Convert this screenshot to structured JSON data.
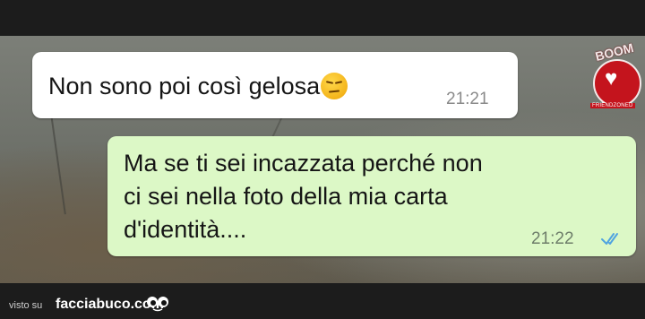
{
  "chat": {
    "received": {
      "text": "Non sono poi così gelosa",
      "emoji": "unamused-face-emoji",
      "time": "21:21"
    },
    "sent": {
      "lines": [
        "Ma se ti sei incazzata perché non",
        "ci sei nella foto della mia carta",
        "d'identità...."
      ],
      "time": "21:22",
      "status": "read-double-check"
    }
  },
  "watermark": {
    "logo_text": "BOOM",
    "logo_sub": "FRIENDZONED"
  },
  "footer": {
    "prefix": "visto su",
    "site": "facciabuco.com"
  },
  "colors": {
    "received_bubble": "#ffffff",
    "sent_bubble": "#dcf8c6",
    "read_ticks": "#4fa3e0",
    "logo_red": "#c4141d"
  }
}
